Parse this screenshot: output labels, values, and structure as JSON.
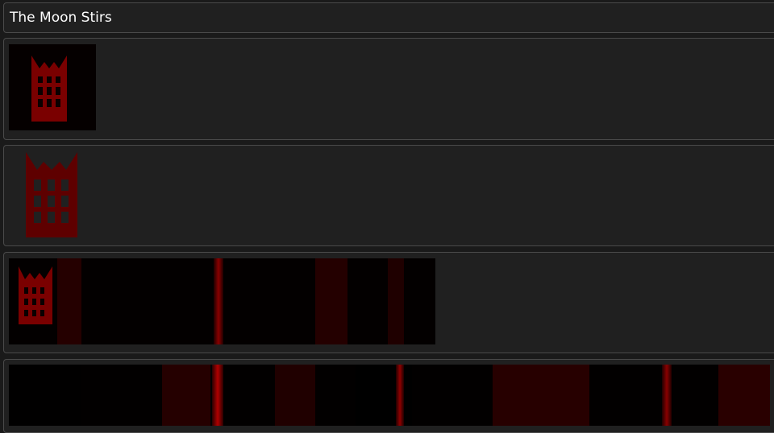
{
  "header": {
    "title": "The Moon Stirs"
  },
  "images": [
    {
      "name": "castle-icon-small",
      "description_icon": "castle-gate-icon"
    },
    {
      "name": "castle-icon-plain",
      "description_icon": "castle-gate-icon"
    },
    {
      "name": "castle-forest-banner",
      "description_icon": "castle-gate-icon"
    },
    {
      "name": "red-forest-banner",
      "description_icon": "forest-image"
    }
  ],
  "colors": {
    "background": "#202020",
    "border": "#4a4a4a",
    "castle": "#6e0000",
    "forest_highlight": "#b00000"
  }
}
